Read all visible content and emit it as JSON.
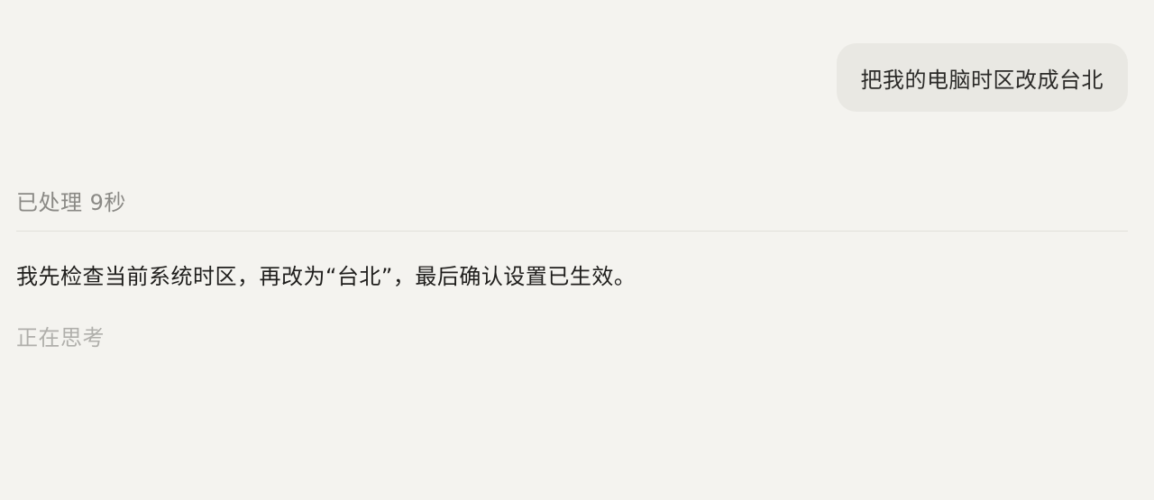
{
  "user_message": {
    "text": "把我的电脑时区改成台北"
  },
  "assistant": {
    "processed_label": "已处理 9秒",
    "response": "我先检查当前系统时区，再改为“台北”，最后确认设置已生效。",
    "thinking_label": "正在思考"
  },
  "colors": {
    "background": "#f4f3ef",
    "user_bubble": "#e9e8e3",
    "muted_text": "#8a8985",
    "thinking_text": "#b0afab",
    "primary_text": "#1f1e1c"
  }
}
